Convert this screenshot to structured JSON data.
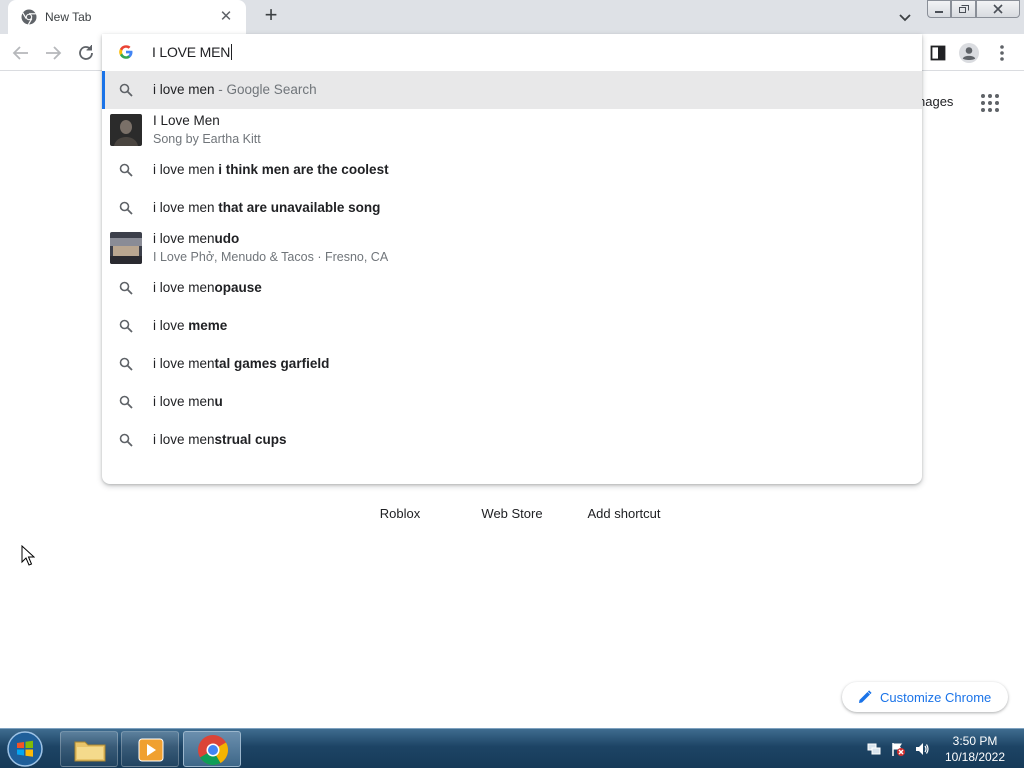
{
  "tab": {
    "title": "New Tab",
    "close": "✕",
    "new_tab": "+"
  },
  "omnibox": {
    "text": "I LOVE MEN"
  },
  "suggestions": [
    {
      "type": "search",
      "plain": "i love men",
      "bold": "",
      "suffix": " - Google Search",
      "selected": true
    },
    {
      "type": "entity",
      "line1": "I Love Men",
      "line2": "Song by Eartha Kitt"
    },
    {
      "type": "search",
      "plain": "i love men ",
      "bold": "i think men are the coolest"
    },
    {
      "type": "search",
      "plain": "i love men ",
      "bold": "that are unavailable song"
    },
    {
      "type": "entity",
      "plain": "i love men",
      "bold": "udo",
      "line2": "I Love Phở, Menudo & Tacos · Fresno, CA"
    },
    {
      "type": "search",
      "plain": "i love men",
      "bold": "opause"
    },
    {
      "type": "search",
      "plain": "i love ",
      "bold": "meme"
    },
    {
      "type": "search",
      "plain": "i love men",
      "bold": "tal games garfield"
    },
    {
      "type": "search",
      "plain": "i love men",
      "bold": "u"
    },
    {
      "type": "search",
      "plain": "i love men",
      "bold": "strual cups"
    }
  ],
  "page": {
    "images_link": "nages",
    "shortcuts": [
      "Roblox",
      "Web Store",
      "Add shortcut"
    ],
    "customize": "Customize Chrome"
  },
  "taskbar": {
    "time": "3:50 PM",
    "date": "10/18/2022"
  },
  "colors": {
    "accent": "#1a73e8",
    "tabstrip": "#dee1e6",
    "taskbar": "#1d4465"
  }
}
